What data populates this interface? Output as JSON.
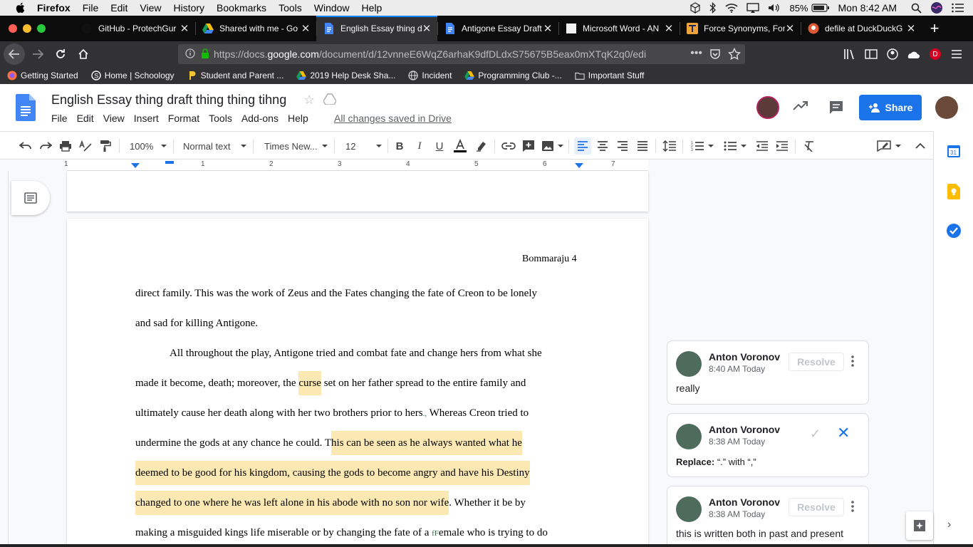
{
  "mac_menubar": {
    "app": "Firefox",
    "menus": [
      "File",
      "Edit",
      "View",
      "History",
      "Bookmarks",
      "Tools",
      "Window",
      "Help"
    ],
    "battery": "85%",
    "clock": "Mon 8:42 AM"
  },
  "tabs": [
    {
      "title": "GitHub - ProtechGur",
      "icon": "github-icon"
    },
    {
      "title": "Shared with me - Go",
      "icon": "drive-icon"
    },
    {
      "title": "English Essay thing d",
      "icon": "docs-icon",
      "active": true
    },
    {
      "title": "Antigone Essay Draft",
      "icon": "docs-icon"
    },
    {
      "title": "Microsoft Word - AN",
      "icon": "blank-page-icon"
    },
    {
      "title": "Force Synonyms, For",
      "icon": "thesaurus-icon"
    },
    {
      "title": "defile at DuckDuckG",
      "icon": "duckduckgo-icon"
    }
  ],
  "nav": {
    "url_prefix": "https://docs.",
    "url_domain": "google.com",
    "url_rest": "/document/d/12vnneE6WqZ6arhaK9dfDLdxS75675B5eax0mXTqK2q0/edi",
    "profile_letter": "D"
  },
  "bookmarks": [
    {
      "label": "Getting Started",
      "icon": "firefox-icon"
    },
    {
      "label": "Home | Schoology",
      "icon": "schoology-icon"
    },
    {
      "label": "Student and Parent ...",
      "icon": "p-logo-icon"
    },
    {
      "label": "2019 Help Desk Sha...",
      "icon": "drive-icon"
    },
    {
      "label": "Incident",
      "icon": "globe-icon"
    },
    {
      "label": "Programming Club -...",
      "icon": "drive-icon"
    },
    {
      "label": "Important Stuff",
      "icon": "folder-icon"
    }
  ],
  "doc": {
    "title": "English Essay thing draft thing thing tihng",
    "menus": [
      "File",
      "Edit",
      "View",
      "Insert",
      "Format",
      "Tools",
      "Add-ons",
      "Help"
    ],
    "save_status": "All changes saved in Drive",
    "share_label": "Share"
  },
  "toolbar": {
    "zoom": "100%",
    "style": "Normal text",
    "font": "Times New...",
    "size": "12"
  },
  "ruler_numbers": [
    "1",
    "1",
    "2",
    "3",
    "4",
    "5",
    "6",
    "7"
  ],
  "page": {
    "header": "Bommaraju 4",
    "lines": [
      {
        "parts": [
          {
            "t": "direct family. This was the work of Zeus and the Fates changing the fate of Creon to be lonely"
          }
        ]
      },
      {
        "parts": [
          {
            "t": "and sad for killing Antigone."
          }
        ]
      },
      {
        "parts": [
          {
            "t": "All throughout the play, Antigone tried and combat fate and change hers from what she"
          }
        ],
        "indent": true
      },
      {
        "parts": [
          {
            "t": "made it become, death; moreover, the "
          },
          {
            "t": "curse",
            "hl": true
          },
          {
            "t": " set on her father spread to the entire family and"
          }
        ]
      },
      {
        "parts": [
          {
            "t": "ultimately cause her death along with her two brothers prior to hers"
          },
          {
            "t": ".,",
            "sug": true
          },
          {
            "t": " Whereas Creon tried to"
          }
        ]
      },
      {
        "parts": [
          {
            "t": "undermine the gods at any chance he could. T"
          },
          {
            "t": "his can be seen as he always wanted what he",
            "hl": true
          }
        ]
      },
      {
        "parts": [
          {
            "t": "deemed to be good for his kingdom, causing the gods to become angry and have his Destiny",
            "hl": true
          }
        ]
      },
      {
        "parts": [
          {
            "t": "changed to one where he was left alone in his abode with no son nor wife",
            "hl": true
          },
          {
            "t": ". Whether it be by"
          }
        ]
      },
      {
        "parts": [
          {
            "t": "making a misguided kings life miserable or by changing the fate of a "
          },
          {
            "t": "fF",
            "sug": true
          },
          {
            "t": "emale who is trying to do"
          }
        ]
      }
    ]
  },
  "comments": [
    {
      "author": "Anton Voronov",
      "time": "8:40 AM Today",
      "body": "really",
      "action": "Resolve"
    },
    {
      "author": "Anton Voronov",
      "time": "8:38 AM Today",
      "body_label": "Replace:",
      "body": " “.” with “,”"
    },
    {
      "author": "Anton Voronov",
      "time": "8:38 AM Today",
      "body": "this is written both in past and present",
      "action": "Resolve"
    }
  ]
}
